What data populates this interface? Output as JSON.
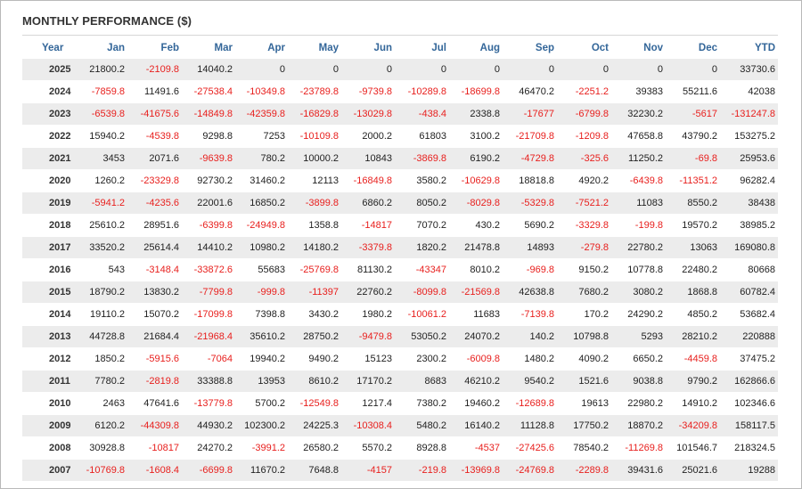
{
  "title": "MONTHLY PERFORMANCE ($)",
  "colors": {
    "negative": "#e8201e",
    "header": "#336699",
    "stripe": "#ececec"
  },
  "columns": [
    "Year",
    "Jan",
    "Feb",
    "Mar",
    "Apr",
    "May",
    "Jun",
    "Jul",
    "Aug",
    "Sep",
    "Oct",
    "Nov",
    "Dec",
    "YTD"
  ],
  "rows": [
    [
      "2025",
      "21800.2",
      "-2109.8",
      "14040.2",
      "0",
      "0",
      "0",
      "0",
      "0",
      "0",
      "0",
      "0",
      "0",
      "33730.6"
    ],
    [
      "2024",
      "-7859.8",
      "11491.6",
      "-27538.4",
      "-10349.8",
      "-23789.8",
      "-9739.8",
      "-10289.8",
      "-18699.8",
      "46470.2",
      "-2251.2",
      "39383",
      "55211.6",
      "42038"
    ],
    [
      "2023",
      "-6539.8",
      "-41675.6",
      "-14849.8",
      "-42359.8",
      "-16829.8",
      "-13029.8",
      "-438.4",
      "2338.8",
      "-17677",
      "-6799.8",
      "32230.2",
      "-5617",
      "-131247.8"
    ],
    [
      "2022",
      "15940.2",
      "-4539.8",
      "9298.8",
      "7253",
      "-10109.8",
      "2000.2",
      "61803",
      "3100.2",
      "-21709.8",
      "-1209.8",
      "47658.8",
      "43790.2",
      "153275.2"
    ],
    [
      "2021",
      "3453",
      "2071.6",
      "-9639.8",
      "780.2",
      "10000.2",
      "10843",
      "-3869.8",
      "6190.2",
      "-4729.8",
      "-325.6",
      "11250.2",
      "-69.8",
      "25953.6"
    ],
    [
      "2020",
      "1260.2",
      "-23329.8",
      "92730.2",
      "31460.2",
      "12113",
      "-16849.8",
      "3580.2",
      "-10629.8",
      "18818.8",
      "4920.2",
      "-6439.8",
      "-11351.2",
      "96282.4"
    ],
    [
      "2019",
      "-5941.2",
      "-4235.6",
      "22001.6",
      "16850.2",
      "-3899.8",
      "6860.2",
      "8050.2",
      "-8029.8",
      "-5329.8",
      "-7521.2",
      "11083",
      "8550.2",
      "38438"
    ],
    [
      "2018",
      "25610.2",
      "28951.6",
      "-6399.8",
      "-24949.8",
      "1358.8",
      "-14817",
      "7070.2",
      "430.2",
      "5690.2",
      "-3329.8",
      "-199.8",
      "19570.2",
      "38985.2"
    ],
    [
      "2017",
      "33520.2",
      "25614.4",
      "14410.2",
      "10980.2",
      "14180.2",
      "-3379.8",
      "1820.2",
      "21478.8",
      "14893",
      "-279.8",
      "22780.2",
      "13063",
      "169080.8"
    ],
    [
      "2016",
      "543",
      "-3148.4",
      "-33872.6",
      "55683",
      "-25769.8",
      "81130.2",
      "-43347",
      "8010.2",
      "-969.8",
      "9150.2",
      "10778.8",
      "22480.2",
      "80668"
    ],
    [
      "2015",
      "18790.2",
      "13830.2",
      "-7799.8",
      "-999.8",
      "-11397",
      "22760.2",
      "-8099.8",
      "-21569.8",
      "42638.8",
      "7680.2",
      "3080.2",
      "1868.8",
      "60782.4"
    ],
    [
      "2014",
      "19110.2",
      "15070.2",
      "-17099.8",
      "7398.8",
      "3430.2",
      "1980.2",
      "-10061.2",
      "11683",
      "-7139.8",
      "170.2",
      "24290.2",
      "4850.2",
      "53682.4"
    ],
    [
      "2013",
      "44728.8",
      "21684.4",
      "-21968.4",
      "35610.2",
      "28750.2",
      "-9479.8",
      "53050.2",
      "24070.2",
      "140.2",
      "10798.8",
      "5293",
      "28210.2",
      "220888"
    ],
    [
      "2012",
      "1850.2",
      "-5915.6",
      "-7064",
      "19940.2",
      "9490.2",
      "15123",
      "2300.2",
      "-6009.8",
      "1480.2",
      "4090.2",
      "6650.2",
      "-4459.8",
      "37475.2"
    ],
    [
      "2011",
      "7780.2",
      "-2819.8",
      "33388.8",
      "13953",
      "8610.2",
      "17170.2",
      "8683",
      "46210.2",
      "9540.2",
      "1521.6",
      "9038.8",
      "9790.2",
      "162866.6"
    ],
    [
      "2010",
      "2463",
      "47641.6",
      "-13779.8",
      "5700.2",
      "-12549.8",
      "1217.4",
      "7380.2",
      "19460.2",
      "-12689.8",
      "19613",
      "22980.2",
      "14910.2",
      "102346.6"
    ],
    [
      "2009",
      "6120.2",
      "-44309.8",
      "44930.2",
      "102300.2",
      "24225.3",
      "-10308.4",
      "5480.2",
      "16140.2",
      "11128.8",
      "17750.2",
      "18870.2",
      "-34209.8",
      "158117.5"
    ],
    [
      "2008",
      "30928.8",
      "-10817",
      "24270.2",
      "-3991.2",
      "26580.2",
      "5570.2",
      "8928.8",
      "-4537",
      "-27425.6",
      "78540.2",
      "-11269.8",
      "101546.7",
      "218324.5"
    ],
    [
      "2007",
      "-10769.8",
      "-1608.4",
      "-6699.8",
      "11670.2",
      "7648.8",
      "-4157",
      "-219.8",
      "-13969.8",
      "-24769.8",
      "-2289.8",
      "39431.6",
      "25021.6",
      "19288"
    ]
  ]
}
